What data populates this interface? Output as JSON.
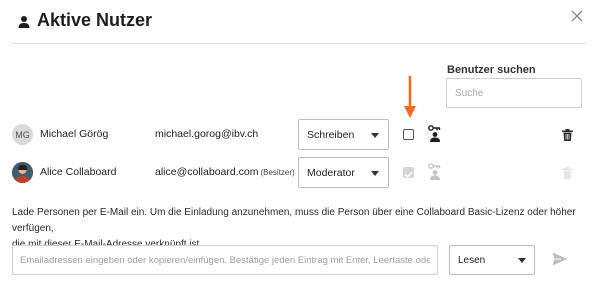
{
  "dialog": {
    "title": "Aktive Nutzer",
    "title_icon": "user-icon",
    "close_icon": "close-icon"
  },
  "search": {
    "label": "Benutzer suchen",
    "placeholder": "Suche"
  },
  "colors": {
    "accent_arrow": "#f26a1b",
    "checked_checkbox": "#d6d6d6",
    "text": "#222222"
  },
  "users": [
    {
      "avatar_initials": "MG",
      "name": "Michael Görög",
      "email": "michael.gorog@ibv.ch",
      "owner_tag": "",
      "role": "Schreiben",
      "checkbox_checked": false,
      "permission_icon": "key-user-icon",
      "delete_icon": "trash-icon"
    },
    {
      "avatar_initials": "",
      "name": "Alice Collaboard",
      "email": "alice@collaboard.com",
      "owner_tag": "(Besitzer)",
      "role": "Moderator",
      "checkbox_checked": true,
      "permission_icon": "key-user-icon",
      "delete_icon": "trash-icon"
    }
  ],
  "invite": {
    "info_text_1": "Lade Personen per E-Mail ein. Um die Einladung anzunehmen, muss die Person über eine Collaboard Basic-Lizenz oder höher verfügen,",
    "info_text_2": "die mit dieser E-Mail-Adresse verknüpft ist.",
    "email_placeholder": "Emailadressen eingeben oder kopieren/einfügen. Bestätige jeden Eintrag mit Enter, Leertaste oder...",
    "role": "Lesen",
    "send_icon": "send-icon"
  }
}
